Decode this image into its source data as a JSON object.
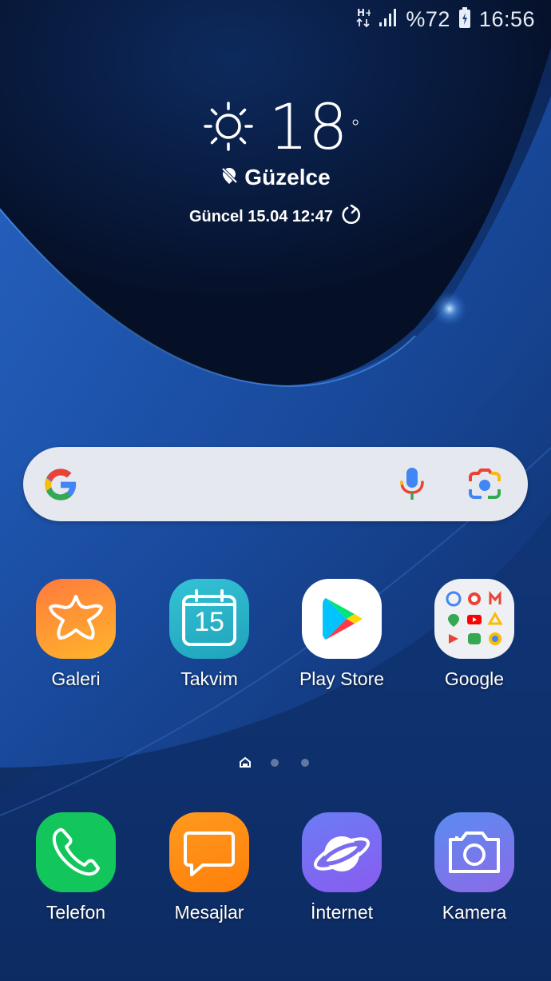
{
  "status_bar": {
    "network_type": "H+",
    "battery": "%72",
    "time": "16:56",
    "icons": [
      "network-type-icon",
      "signal-icon",
      "battery-icon"
    ]
  },
  "weather": {
    "temperature": "18",
    "degree_symbol": "°",
    "location": "Güzelce",
    "updated": "Güncel 15.04 12:47",
    "icons": [
      "sun-icon",
      "location-off-icon",
      "refresh-icon"
    ]
  },
  "search": {
    "icons": [
      "google-g-icon",
      "microphone-icon",
      "google-lens-icon"
    ]
  },
  "apps": [
    {
      "label": "Galeri",
      "icon": "gallery-icon",
      "color": "#ff8a2a"
    },
    {
      "label": "Takvim",
      "icon": "calendar-icon",
      "color": "#2ab3c9",
      "calendar_day": "15"
    },
    {
      "label": "Play Store",
      "icon": "play-store-icon",
      "color": "#ffffff"
    },
    {
      "label": "Google",
      "icon": "google-folder-icon",
      "color": "#eef0f3"
    }
  ],
  "dock": [
    {
      "label": "Telefon",
      "icon": "phone-icon",
      "color": "#12c65c"
    },
    {
      "label": "Mesajlar",
      "icon": "messages-icon",
      "color": "#ff8a12"
    },
    {
      "label": "İnternet",
      "icon": "internet-icon",
      "color": "#7a6cf0"
    },
    {
      "label": "Kamera",
      "icon": "camera-icon",
      "color": "#6d78e6"
    }
  ],
  "page_indicator": {
    "pages": 3,
    "current": 1
  }
}
